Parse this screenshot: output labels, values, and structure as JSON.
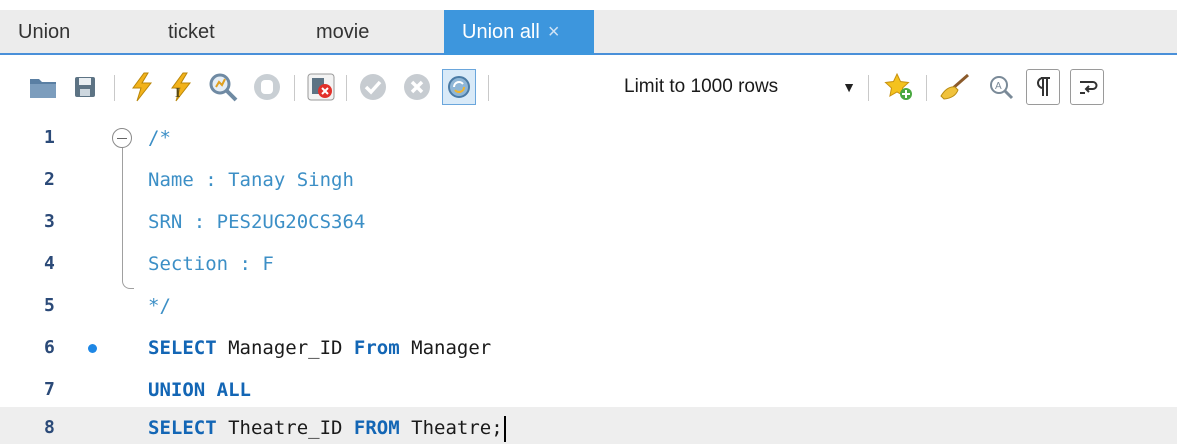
{
  "tabs": [
    {
      "label": "Union",
      "active": false
    },
    {
      "label": "ticket",
      "active": false
    },
    {
      "label": "movie",
      "active": false
    },
    {
      "label": "Union all",
      "active": true
    }
  ],
  "tab_close_glyph": "×",
  "toolbar": {
    "icons": [
      "open-folder-icon",
      "save-icon",
      "execute-icon",
      "execute-current-icon",
      "explain-icon",
      "stop-icon",
      "toggle-error-stop-icon",
      "commit-icon",
      "rollback-icon",
      "autocommit-icon",
      "add-snippet-icon",
      "beautify-icon",
      "find-icon",
      "invisible-chars-icon",
      "word-wrap-icon"
    ],
    "limit_select": "Limit to 1000 rows"
  },
  "editor": {
    "lines": [
      {
        "num": "1",
        "text": "/*"
      },
      {
        "num": "2",
        "text": "Name : Tanay Singh"
      },
      {
        "num": "3",
        "text": "SRN : PES2UG20CS364"
      },
      {
        "num": "4",
        "text": "Section : F"
      },
      {
        "num": "5",
        "text": "*/"
      },
      {
        "num": "6",
        "kw1": "SELECT",
        "t1": " Manager_ID ",
        "kw2": "From",
        "t2": " Manager"
      },
      {
        "num": "7",
        "kw1": "UNION ALL"
      },
      {
        "num": "8",
        "kw1": "SELECT",
        "t1": " Theatre_ID ",
        "kw2": "FROM",
        "t2": " Theatre;"
      }
    ]
  },
  "colors": {
    "active_tab": "#3d96dd",
    "comment": "#3c8fc6",
    "keyword": "#1366b5",
    "line_number": "#2b4a78",
    "marker": "#1e87e5"
  }
}
